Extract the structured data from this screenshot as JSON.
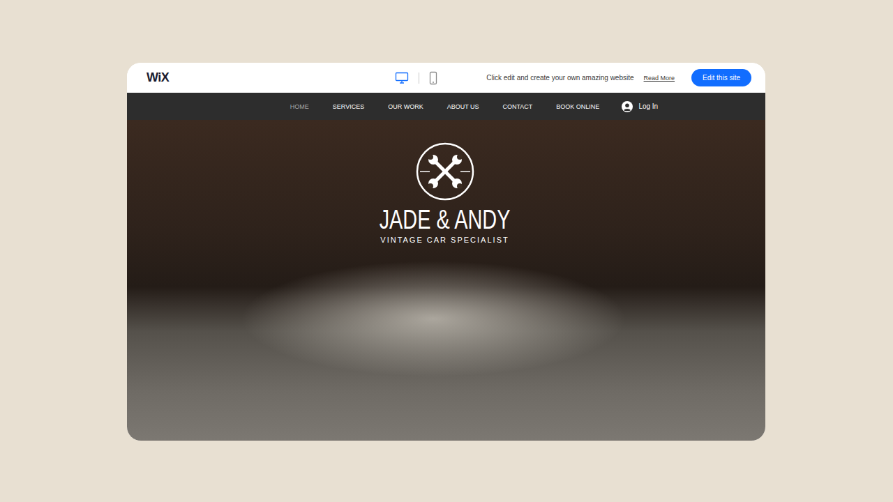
{
  "editor_bar": {
    "logo": "WiX",
    "devices": [
      {
        "kind": "desktop",
        "selected": true
      },
      {
        "kind": "mobile",
        "selected": false
      }
    ],
    "message": "Click edit and create your own amazing website",
    "link": "Read More",
    "button": "Edit this site"
  },
  "nav": {
    "items": [
      {
        "label": "HOME",
        "selected": true
      },
      {
        "label": "SERVICES",
        "selected": false
      },
      {
        "label": "OUR WORK",
        "selected": false
      },
      {
        "label": "ABOUT US",
        "selected": false
      },
      {
        "label": "CONTACT",
        "selected": false
      },
      {
        "label": "BOOK ONLINE",
        "selected": false
      }
    ],
    "login": "Log In"
  },
  "hero": {
    "title": "JADE & ANDY",
    "subtitle": "VINTAGE CAR SPECIALIST"
  }
}
